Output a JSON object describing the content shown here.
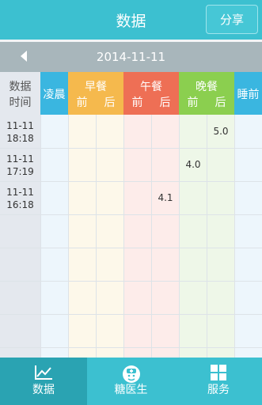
{
  "header": {
    "title": "数据",
    "share_label": "分享"
  },
  "date_nav": {
    "date": "2014-11-11"
  },
  "table": {
    "headers": {
      "time": [
        "数据",
        "时间"
      ],
      "dawn": "凌晨",
      "breakfast": {
        "name": "早餐",
        "before": "前",
        "after": "后"
      },
      "lunch": {
        "name": "午餐",
        "before": "前",
        "after": "后"
      },
      "dinner": {
        "name": "晚餐",
        "before": "前",
        "after": "后"
      },
      "bedtime": "睡前"
    },
    "rows": [
      {
        "date": "11-11",
        "time": "18:18",
        "value": "5.0",
        "column": "dinner_after"
      },
      {
        "date": "11-11",
        "time": "17:19",
        "value": "4.0",
        "column": "dinner_before"
      },
      {
        "date": "11-11",
        "time": "16:18",
        "value": "4.1",
        "column": "lunch_after"
      }
    ]
  },
  "tabs": [
    {
      "label": "数据",
      "icon": "line-chart-icon",
      "active": true
    },
    {
      "label": "糖医生",
      "icon": "doctor-icon",
      "active": false
    },
    {
      "label": "服务",
      "icon": "grid-icon",
      "active": false
    }
  ],
  "colors": {
    "primary": "#3cc0d0",
    "breakfast": "#f5b94d",
    "lunch": "#ee6f55",
    "dinner": "#8bcf4f",
    "dawn": "#3ab6e0"
  }
}
